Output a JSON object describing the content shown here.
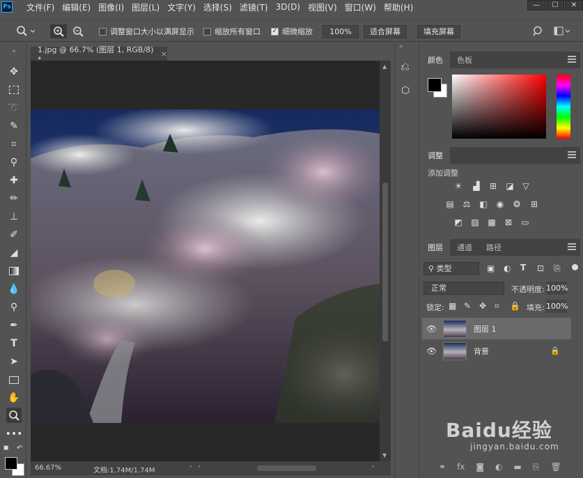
{
  "app": {
    "logo": "Ps"
  },
  "menu": [
    "文件(F)",
    "编辑(E)",
    "图像(I)",
    "图层(L)",
    "文字(Y)",
    "选择(S)",
    "滤镜(T)",
    "3D(D)",
    "视图(V)",
    "窗口(W)",
    "帮助(H)"
  ],
  "window_buttons": {
    "minimize": "—",
    "maximize": "☐",
    "close": "✕"
  },
  "options": {
    "resize_window_label": "调整窗口大小以满屏显示",
    "zoom_all_label": "缩放所有窗口",
    "scrubby_zoom_label": "细微缩放",
    "zoom_value": "100%",
    "fit_screen_label": "适合屏幕",
    "fill_screen_label": "填充屏幕",
    "resize_window_checked": false,
    "zoom_all_checked": false,
    "scrubby_zoom_checked": true
  },
  "document": {
    "tab_title": "1.jpg @ 66.7% (图层 1, RGB/8) *",
    "tab_close": "×"
  },
  "status": {
    "zoom": "66.67%",
    "doc_size": "文档:1.74M/1.74M"
  },
  "panels": {
    "color": {
      "tabs": [
        "颜色",
        "色板"
      ]
    },
    "adjustments": {
      "tabs": [
        "调整"
      ],
      "add_label": "添加调整"
    },
    "layers": {
      "tabs": [
        "图层",
        "通道",
        "路径"
      ],
      "filter_kind": "类型",
      "blend_mode": "正常",
      "opacity_label": "不透明度:",
      "opacity_value": "100%",
      "lock_label": "锁定:",
      "fill_label": "填充:",
      "fill_value": "100%",
      "items": [
        {
          "name": "图层 1",
          "selected": true
        },
        {
          "name": "背景",
          "selected": false,
          "locked": true
        }
      ]
    }
  },
  "watermark": {
    "brand": "Baidu经验",
    "url": "jingyan.baidu.com"
  },
  "colors": {
    "accent": "#31a8ff",
    "panel": "#535353",
    "dark": "#424242",
    "canvas_bg": "#282828"
  }
}
